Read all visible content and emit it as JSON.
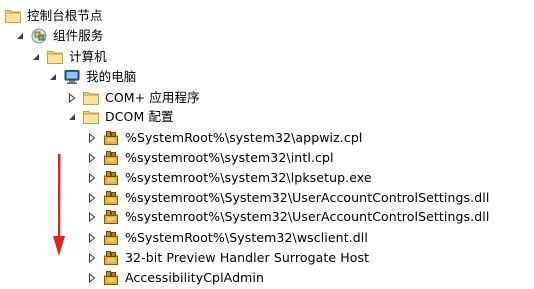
{
  "tree": {
    "root": {
      "label": "控制台根节点",
      "icon": "folder-icon"
    },
    "component_services": {
      "label": "组件服务",
      "icon": "component-services-icon"
    },
    "computers": {
      "label": "计算机",
      "icon": "folder-icon"
    },
    "my_computer": {
      "label": "我的电脑",
      "icon": "computer-icon"
    },
    "com_apps": {
      "label": "COM+ 应用程序",
      "icon": "folder-icon"
    },
    "dcom_config": {
      "label": "DCOM 配置",
      "icon": "folder-icon"
    },
    "dcom_items": [
      {
        "label": "%SystemRoot%\\system32\\appwiz.cpl",
        "icon": "dcom-app-icon"
      },
      {
        "label": "%systemroot%\\system32\\intl.cpl",
        "icon": "dcom-app-icon"
      },
      {
        "label": "%systemroot%\\system32\\lpksetup.exe",
        "icon": "dcom-app-icon"
      },
      {
        "label": "%systemroot%\\System32\\UserAccountControlSettings.dll",
        "icon": "dcom-app-icon"
      },
      {
        "label": "%systemroot%\\System32\\UserAccountControlSettings.dll",
        "icon": "dcom-app-icon"
      },
      {
        "label": "%SystemRoot%\\System32\\wsclient.dll",
        "icon": "dcom-app-icon"
      },
      {
        "label": "32-bit Preview Handler Surrogate Host",
        "icon": "dcom-app-icon"
      },
      {
        "label": "AccessibilityCplAdmin",
        "icon": "dcom-app-icon"
      }
    ]
  },
  "annotation": {
    "icon": "red-down-arrow-icon",
    "color": "#e8201a"
  }
}
